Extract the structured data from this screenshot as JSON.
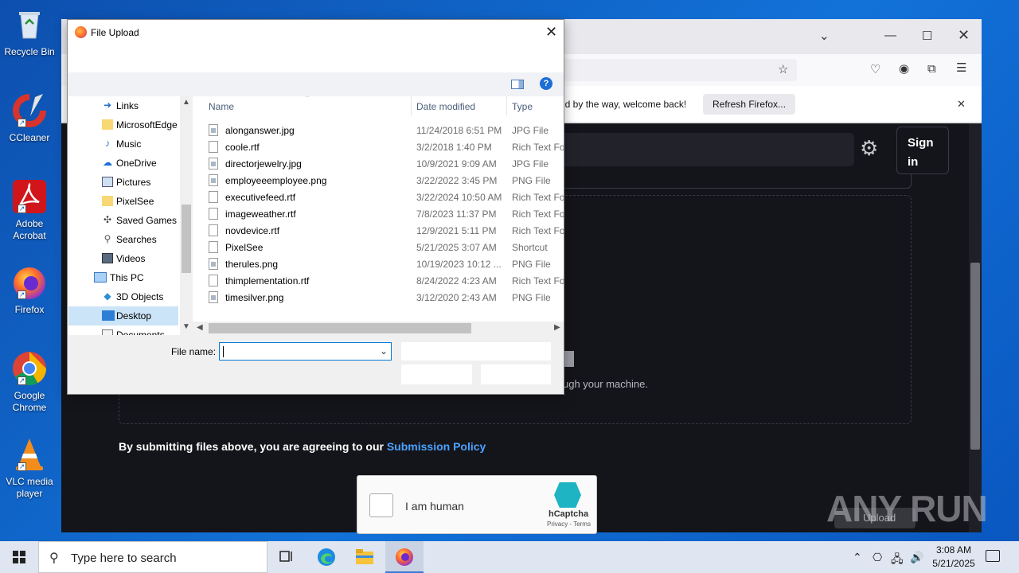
{
  "desktop": {
    "icons": [
      {
        "label": "Recycle Bin"
      },
      {
        "label": "CCleaner"
      },
      {
        "label": "Adobe Acrobat"
      },
      {
        "label": "Firefox"
      },
      {
        "label": "Google Chrome"
      },
      {
        "label": "VLC media player"
      }
    ]
  },
  "browser": {
    "notification_text": "nd by the way, welcome back!",
    "refresh_button": "Refresh Firefox...",
    "sign_in_line1": "Sign",
    "sign_in_line2": "in",
    "through_text": "ugh your machine.",
    "policy_prefix": "By submitting files above, you are agreeing to our",
    "policy_link": "Submission Policy",
    "captcha_label": "I am human",
    "captcha_brand": "hCaptcha",
    "captcha_terms": "Privacy - Terms",
    "upload_ghost": "Upload",
    "watermark": "ANY RUN"
  },
  "dialog": {
    "title": "File Upload",
    "nav_items": [
      {
        "label": "Links",
        "icon": "links-icon"
      },
      {
        "label": "MicrosoftEdge",
        "icon": "folder-icon"
      },
      {
        "label": "Music",
        "icon": "music-icon"
      },
      {
        "label": "OneDrive",
        "icon": "onedrive-icon"
      },
      {
        "label": "Pictures",
        "icon": "pictures-icon"
      },
      {
        "label": "PixelSee",
        "icon": "folder-icon"
      },
      {
        "label": "Saved Games",
        "icon": "saved-games-icon"
      },
      {
        "label": "Searches",
        "icon": "searches-icon"
      },
      {
        "label": "Videos",
        "icon": "videos-icon"
      },
      {
        "label": "This PC",
        "icon": "this-pc-icon"
      },
      {
        "label": "3D Objects",
        "icon": "3d-objects-icon"
      },
      {
        "label": "Desktop",
        "icon": "desktop-icon",
        "selected": true
      },
      {
        "label": "Documents",
        "icon": "documents-icon"
      }
    ],
    "columns": {
      "name": "Name",
      "date": "Date modified",
      "type": "Type"
    },
    "files": [
      {
        "name": "alonganswer.jpg",
        "date": "11/24/2018 6:51 PM",
        "type": "JPG File",
        "kind": "img"
      },
      {
        "name": "coole.rtf",
        "date": "3/2/2018 1:40 PM",
        "type": "Rich Text Format",
        "kind": "doc"
      },
      {
        "name": "directorjewelry.jpg",
        "date": "10/9/2021 9:09 AM",
        "type": "JPG File",
        "kind": "img"
      },
      {
        "name": "employeeemployee.png",
        "date": "3/22/2022 3:45 PM",
        "type": "PNG File",
        "kind": "img"
      },
      {
        "name": "executivefeed.rtf",
        "date": "3/22/2024 10:50 AM",
        "type": "Rich Text Format",
        "kind": "doc"
      },
      {
        "name": "imageweather.rtf",
        "date": "7/8/2023 11:37 PM",
        "type": "Rich Text Format",
        "kind": "doc"
      },
      {
        "name": "novdevice.rtf",
        "date": "12/9/2021 5:11 PM",
        "type": "Rich Text Format",
        "kind": "doc"
      },
      {
        "name": "PixelSee",
        "date": "5/21/2025 3:07 AM",
        "type": "Shortcut",
        "kind": "doc"
      },
      {
        "name": "therules.png",
        "date": "10/19/2023 10:12 ...",
        "type": "PNG File",
        "kind": "img"
      },
      {
        "name": "thimplementation.rtf",
        "date": "8/24/2022 4:23 AM",
        "type": "Rich Text Format",
        "kind": "doc"
      },
      {
        "name": "timesilver.png",
        "date": "3/12/2020 2:43 AM",
        "type": "PNG File",
        "kind": "img"
      }
    ],
    "file_name_label": "File name:",
    "file_name_value": ""
  },
  "taskbar": {
    "search_placeholder": "Type here to search",
    "time": "3:08 AM",
    "date": "5/21/2025"
  },
  "colors": {
    "desktop_blue": "#0b5fd1",
    "page_dark": "#14141b",
    "link_blue": "#4aa3ff",
    "selection": "#cce4f7"
  }
}
